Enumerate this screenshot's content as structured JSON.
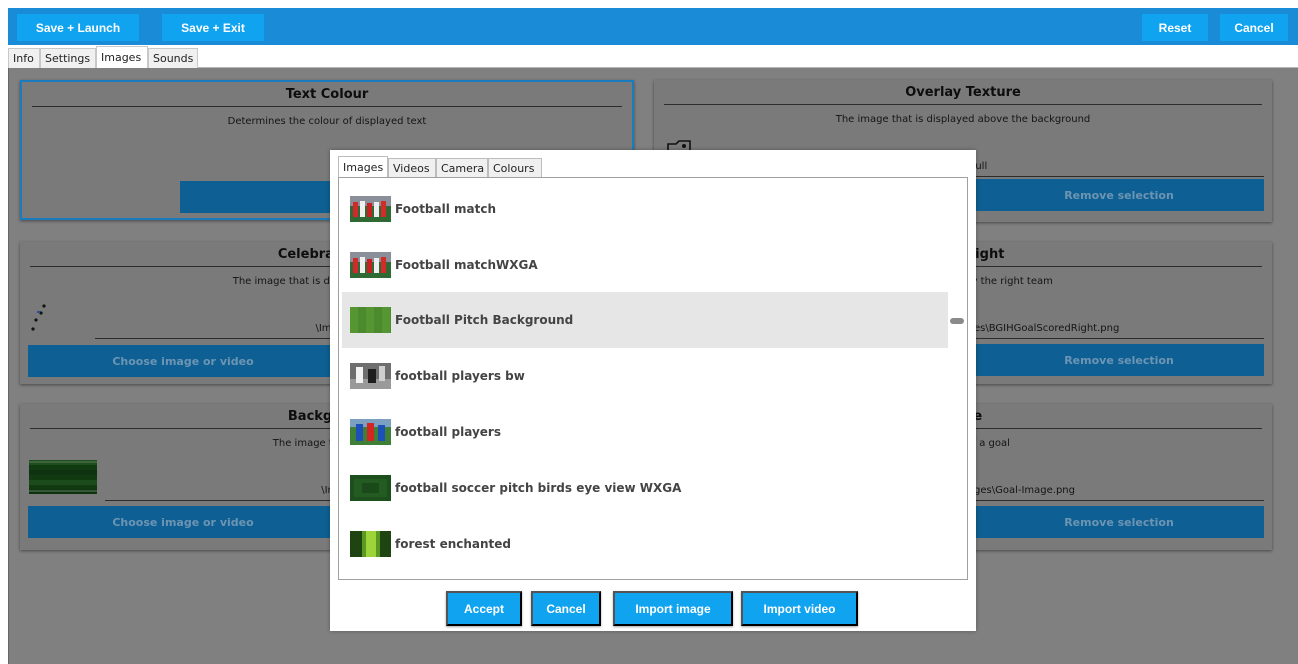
{
  "toolbar": {
    "save_launch": "Save + Launch",
    "save_exit": "Save + Exit",
    "reset": "Reset",
    "cancel": "Cancel"
  },
  "tabs": [
    "Info",
    "Settings",
    "Images",
    "Sounds"
  ],
  "active_tab": "Images",
  "cards": {
    "text_colour": {
      "title": "Text Colour",
      "desc": "Determines the colour of displayed text"
    },
    "overlay_texture": {
      "title": "Overlay Texture",
      "desc": "The image that is displayed above the background",
      "path": "null",
      "remove": "Remove selection"
    },
    "celebration": {
      "title": "Celebration T",
      "desc": "The image that is displayed when the",
      "path": "\\Images\\Overlay Im",
      "choose": "Choose image or video"
    },
    "texture_right": {
      "title": "xture Right",
      "desc": "al limit is reached by the right team",
      "path": "es\\BGIHGoalScoredRight.png",
      "remove": "Remove selection"
    },
    "background": {
      "title": "Backgroun",
      "desc": "The image that is use",
      "path": "\\Images\\Backgroun",
      "choose": "Choose image or video"
    },
    "goal_texture": {
      "title": "cture",
      "desc": "the width of a goal",
      "path": "ges\\Goal-Image.png",
      "remove": "Remove selection"
    }
  },
  "dialog": {
    "tabs": [
      "Images",
      "Videos",
      "Camera",
      "Colours"
    ],
    "active_tab": "Images",
    "items": [
      {
        "label": "Football match",
        "thumb": "football-match"
      },
      {
        "label": "Football matchWXGA",
        "thumb": "football-match"
      },
      {
        "label": "Football Pitch Background",
        "thumb": "pitch"
      },
      {
        "label": "football players bw",
        "thumb": "players-bw"
      },
      {
        "label": "football players",
        "thumb": "players"
      },
      {
        "label": "football soccer pitch birds eye view WXGA",
        "thumb": "pitch-dark"
      },
      {
        "label": "forest enchanted",
        "thumb": "forest"
      }
    ],
    "selected_index": 2,
    "buttons": {
      "accept": "Accept",
      "cancel": "Cancel",
      "import_image": "Import image",
      "import_video": "Import video"
    }
  },
  "colors": {
    "toolbar": "#1a8bd6",
    "button": "#10a3f0",
    "overlay": "#808080",
    "card_button_dim": "#0e5f93"
  }
}
